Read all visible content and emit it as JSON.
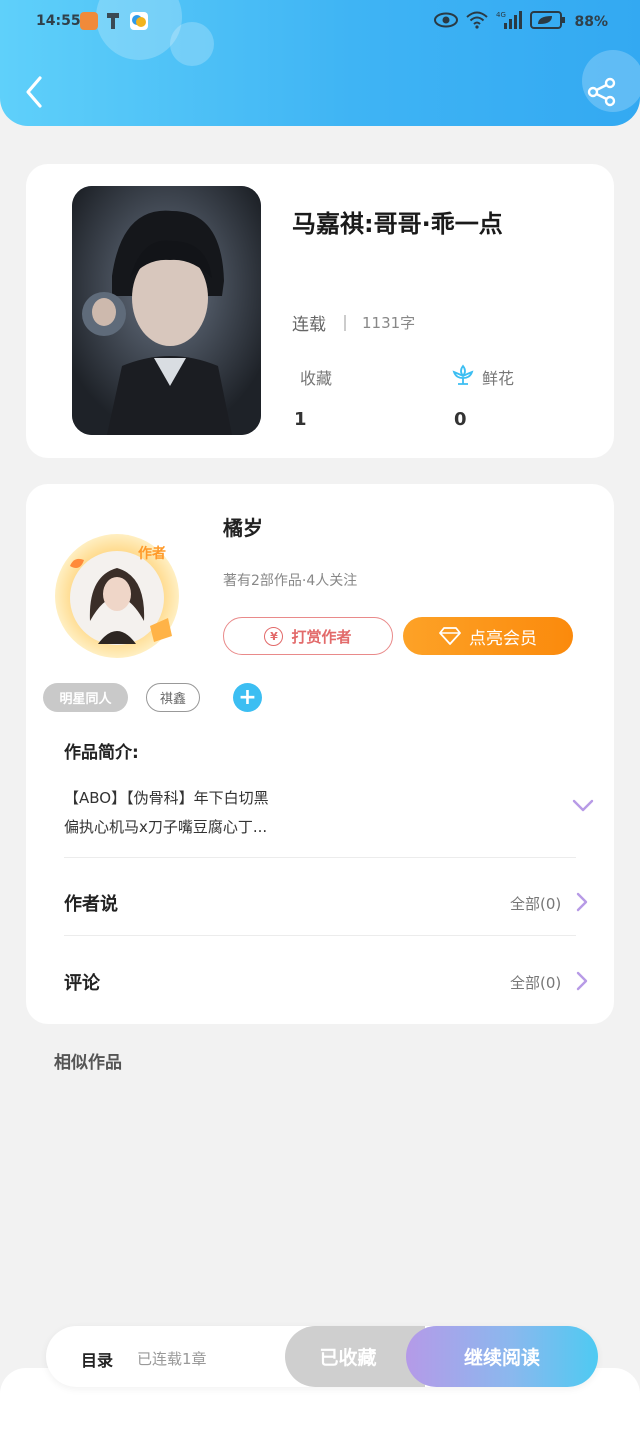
{
  "status_bar": {
    "time": "14:55",
    "battery": "88%"
  },
  "book": {
    "title": "马嘉祺:哥哥·乖一点",
    "status": "连载",
    "word_count": "1131字",
    "collect_label": "收藏",
    "collect_count": "1",
    "flower_label": "鲜花",
    "flower_count": "0"
  },
  "author": {
    "name": "橘岁",
    "meta": "著有2部作品·4人关注",
    "tip_button": "打赏作者",
    "vip_button": "点亮会员",
    "badge": "作者"
  },
  "tags": [
    "明星同人",
    "祺鑫"
  ],
  "intro": {
    "title": "作品简介:",
    "line1": "【ABO】【伪骨科】年下白切黑",
    "line2": "偏执心机马x刀子嘴豆腐心丁..."
  },
  "author_says": {
    "title": "作者说",
    "all": "全部(0)"
  },
  "comments": {
    "title": "评论",
    "all": "全部(0)"
  },
  "similar_title": "相似作品",
  "bottom_bar": {
    "toc": "目录",
    "toc_status": "已连载1章",
    "collected": "已收藏",
    "continue": "继续阅读"
  },
  "colors": {
    "header_start": "#5fd0fa",
    "header_end": "#33a9f2",
    "vip_orange": "#fb8a0c",
    "tip_red": "#e26a6a",
    "accent_blue": "#3cbef2",
    "chevron_purple": "#b79ae6"
  }
}
